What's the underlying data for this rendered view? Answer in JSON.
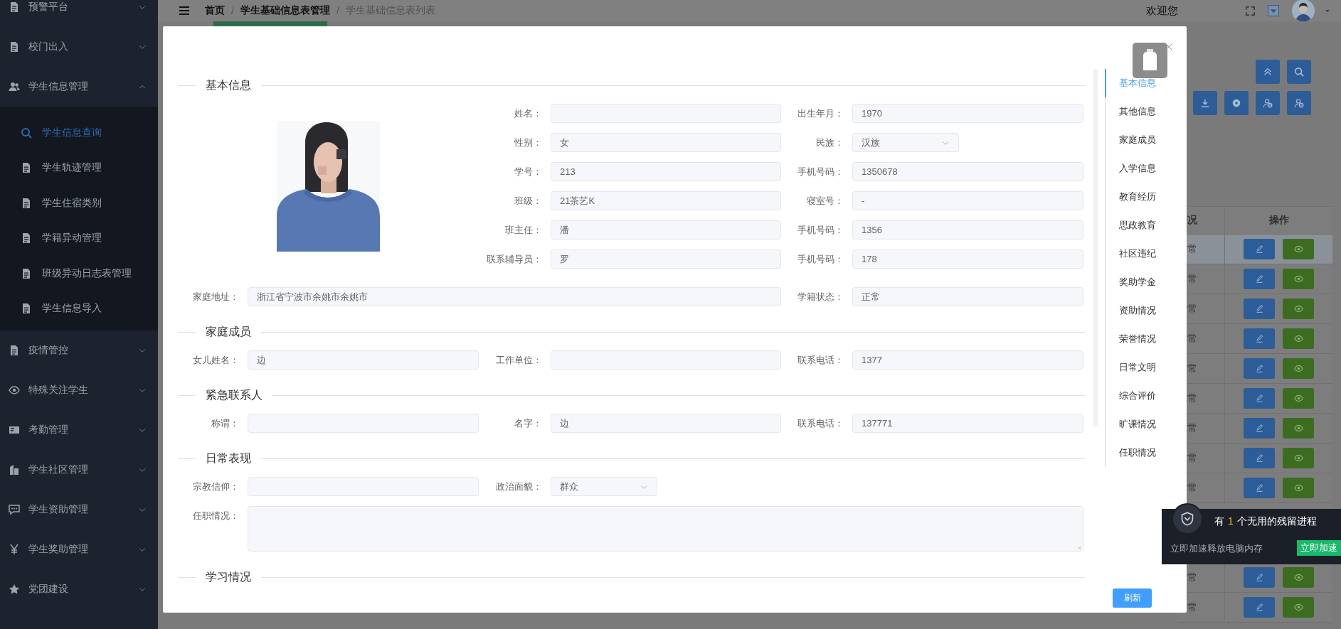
{
  "sidebar": {
    "items": [
      {
        "label": "预警平台",
        "kind": "file",
        "expanded": false
      },
      {
        "label": "校门出入",
        "kind": "file",
        "expanded": false
      },
      {
        "label": "学生信息管理",
        "kind": "users",
        "expanded": true,
        "children": [
          {
            "label": "学生信息查询",
            "kind": "search",
            "selected": true
          },
          {
            "label": "学生轨迹管理",
            "kind": "file",
            "selected": false
          },
          {
            "label": "学生住宿类别",
            "kind": "file",
            "selected": false
          },
          {
            "label": "学籍异动管理",
            "kind": "file",
            "selected": false
          },
          {
            "label": "班级异动日志表管理",
            "kind": "file",
            "selected": false
          },
          {
            "label": "学生信息导入",
            "kind": "file",
            "selected": false
          }
        ]
      },
      {
        "label": "疫情管控",
        "kind": "file",
        "expanded": false
      },
      {
        "label": "特殊关注学生",
        "kind": "eye",
        "expanded": false
      },
      {
        "label": "考勤管理",
        "kind": "card",
        "expanded": false
      },
      {
        "label": "学生社区管理",
        "kind": "building",
        "expanded": false
      },
      {
        "label": "学生资助管理",
        "kind": "chat",
        "expanded": false
      },
      {
        "label": "学生奖助管理",
        "kind": "yen",
        "expanded": false
      },
      {
        "label": "党团建设",
        "kind": "star",
        "expanded": false
      }
    ]
  },
  "header": {
    "breadcrumb": [
      {
        "label": "首页",
        "current": false
      },
      {
        "label": "学生基础信息表管理",
        "current": false
      },
      {
        "label": "学生基础信息表列表",
        "current": true
      }
    ],
    "separators": [
      "/",
      "/"
    ],
    "greeting": "欢迎您"
  },
  "toolbar": {
    "buttons": [
      {
        "kind": "collapse"
      },
      {
        "kind": "search"
      },
      {
        "kind": "download"
      },
      {
        "kind": "coin"
      },
      {
        "kind": "user-add"
      },
      {
        "kind": "user-remove"
      }
    ]
  },
  "table": {
    "columns": [
      "况",
      "操作"
    ],
    "rows": [
      {
        "column_1": "常",
        "selected": true
      },
      {
        "column_1": "常",
        "selected": false
      },
      {
        "column_1": "常",
        "selected": false
      },
      {
        "column_1": "常",
        "selected": false
      },
      {
        "column_1": "常",
        "selected": false
      },
      {
        "column_1": "常",
        "selected": false
      },
      {
        "column_1": "常",
        "selected": false
      },
      {
        "column_1": "常",
        "selected": false
      },
      {
        "column_1": "常",
        "selected": false
      },
      {},
      {},
      {
        "column_1": "常",
        "selected": false
      },
      {
        "column_1": "常",
        "selected": false
      }
    ]
  },
  "dialog": {
    "sections": [
      {
        "title": "基本信息",
        "kind": "profile",
        "fields": [
          {
            "label": "姓名：",
            "kind": "input"
          },
          {
            "label": "出生年月：",
            "value": "1970",
            "kind": "input"
          },
          {
            "label": "性别：",
            "value": "女",
            "kind": "input"
          },
          {
            "label": "民族：",
            "value": "汉族",
            "kind": "select"
          },
          {
            "label": "学号：",
            "value": "213",
            "kind": "input"
          },
          {
            "label": "手机号码：",
            "value": "1350678",
            "kind": "input"
          },
          {
            "label": "班级：",
            "value": "21茶艺K",
            "kind": "input"
          },
          {
            "label": "寝室号：",
            "value": "-",
            "kind": "input"
          },
          {
            "label": "班主任：",
            "value": "潘",
            "kind": "input"
          },
          {
            "label": "手机号码：",
            "value": "1356",
            "kind": "input"
          },
          {
            "label": "联系辅导员：",
            "value": "罗",
            "kind": "input"
          },
          {
            "label": "手机号码：",
            "value": "178",
            "kind": "input"
          }
        ],
        "row_fields": [
          {
            "label": "家庭地址：",
            "value": "浙江省宁波市余姚市余姚市",
            "kind": "input"
          },
          {
            "label": "学籍状态：",
            "value": "正常",
            "kind": "input"
          }
        ]
      },
      {
        "title": "家庭成员",
        "kind": "grid",
        "fields": [
          {
            "label": "女儿姓名：",
            "value": "边",
            "kind": "input"
          },
          {
            "label": "工作单位：",
            "kind": "input"
          },
          {
            "label": "联系电话：",
            "value": "1377",
            "kind": "input"
          }
        ]
      },
      {
        "title": "紧急联系人",
        "kind": "grid",
        "fields": [
          {
            "label": "称谓：",
            "kind": "input"
          },
          {
            "label": "名字：",
            "value": "边",
            "kind": "input"
          },
          {
            "label": "联系电话：",
            "value": "137771",
            "kind": "input"
          }
        ]
      },
      {
        "title": "日常表现",
        "kind": "grid",
        "fields": [
          {
            "label": "宗教信仰：",
            "kind": "input"
          },
          {
            "label": "政治面貌：",
            "value": "群众",
            "kind": "select"
          },
          {
            "label": "任职情况：",
            "kind": "textarea"
          }
        ]
      },
      {
        "title": "学习情况",
        "kind": "empty"
      }
    ],
    "nav": [
      {
        "label": "基本信息",
        "selected": true
      },
      {
        "label": "其他信息",
        "selected": false
      },
      {
        "label": "家庭成员",
        "selected": false
      },
      {
        "label": "入学信息",
        "selected": false
      },
      {
        "label": "教育经历",
        "selected": false
      },
      {
        "label": "思政教育",
        "selected": false
      },
      {
        "label": "社区违纪",
        "selected": false
      },
      {
        "label": "奖助学金",
        "selected": false
      },
      {
        "label": "资助情况",
        "selected": false
      },
      {
        "label": "荣誉情况",
        "selected": false
      },
      {
        "label": "日常文明",
        "selected": false
      },
      {
        "label": "综合评价",
        "selected": false
      },
      {
        "label": "旷课情况",
        "selected": false
      },
      {
        "label": "任职情况",
        "selected": false
      }
    ],
    "refresh_button": "刷新"
  },
  "notification": {
    "text_before": "有",
    "count": "1",
    "text_after": "个无用的残留进程",
    "message": "立即加速释放电脑内存",
    "button": "立即加速"
  }
}
